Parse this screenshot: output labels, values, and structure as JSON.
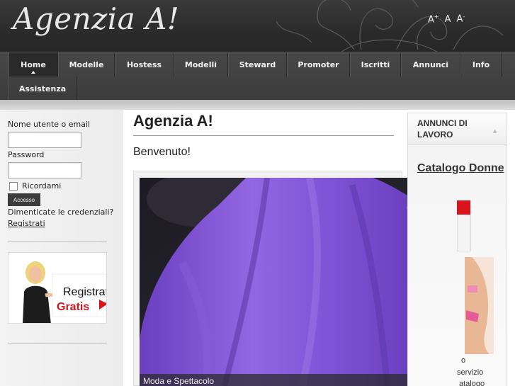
{
  "header": {
    "logo_text": "Agenzia A!",
    "font_tools": {
      "increase": "A",
      "increase_sup": "+",
      "reset": "A",
      "decrease": "A",
      "decrease_sup": "-"
    }
  },
  "nav": {
    "items": [
      {
        "label": "Home",
        "active": true
      },
      {
        "label": "Modelle"
      },
      {
        "label": "Hostess"
      },
      {
        "label": "Modelli"
      },
      {
        "label": "Steward"
      },
      {
        "label": "Promoter"
      },
      {
        "label": "Iscritti"
      },
      {
        "label": "Annunci"
      },
      {
        "label": "Info"
      },
      {
        "label": "Assistenza"
      }
    ]
  },
  "login": {
    "username_label": "Nome utente o email",
    "password_label": "Password",
    "remember_label": "Ricordami",
    "submit_label": "Accesso",
    "forgot_link": "Dimenticate le credenziali?",
    "register_link": "Registrati"
  },
  "banner": {
    "line1": "Registrati",
    "line2": "Gratis"
  },
  "main": {
    "title": "Agenzia A!",
    "welcome": "Benvenuto!",
    "slide_caption": "Moda e Spettacolo"
  },
  "right": {
    "heading": "ANNUNCI DI LAVORO",
    "catalog_title": "Catalogo Donne",
    "text_line1": "o",
    "text_line2": "servizio",
    "text_line3": "atalogo"
  },
  "colors": {
    "header_bg": "#2b2b2b",
    "nav_bg": "#444444",
    "nav_active": "#2a2a2a",
    "slide_purple": "#8a5bd8",
    "banner_red": "#d9141c"
  }
}
